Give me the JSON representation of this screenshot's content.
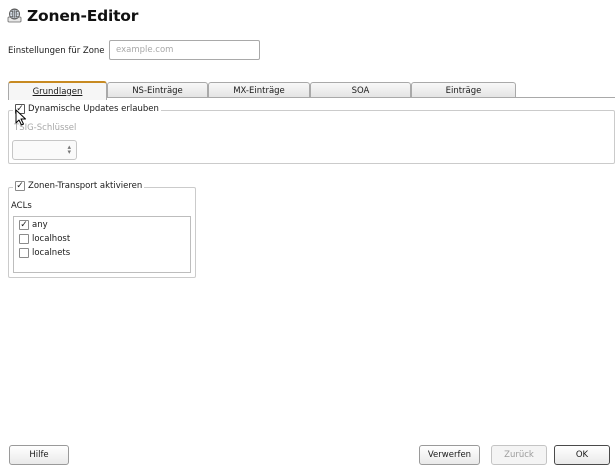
{
  "title": "Zonen-Editor",
  "app_icon": "dns-globe-icon",
  "zone": {
    "label": "Einstellungen für Zone",
    "placeholder": "example.com"
  },
  "tabs": [
    {
      "label": "Grundlagen",
      "active": true
    },
    {
      "label": "NS-Einträge",
      "active": false
    },
    {
      "label": "MX-Einträge",
      "active": false
    },
    {
      "label": "SOA",
      "active": false
    },
    {
      "label": "Einträge",
      "active": false
    }
  ],
  "dynamic_updates": {
    "label": "Dynamische Updates erlauben",
    "checked": true,
    "tsig_label": "TSIG-Schlüssel",
    "tsig_value": ""
  },
  "zone_transport": {
    "label": "Zonen-Transport aktivieren",
    "checked": true,
    "acl_label": "ACLs",
    "acls": [
      {
        "label": "any",
        "checked": true
      },
      {
        "label": "localhost",
        "checked": false
      },
      {
        "label": "localnets",
        "checked": false
      }
    ]
  },
  "buttons": {
    "help": "Hilfe",
    "discard": "Verwerfen",
    "back": "Zurück",
    "ok": "OK"
  },
  "colors": {
    "active_tab_accent": "#c78a22",
    "disabled_text": "#a7a7a7"
  }
}
